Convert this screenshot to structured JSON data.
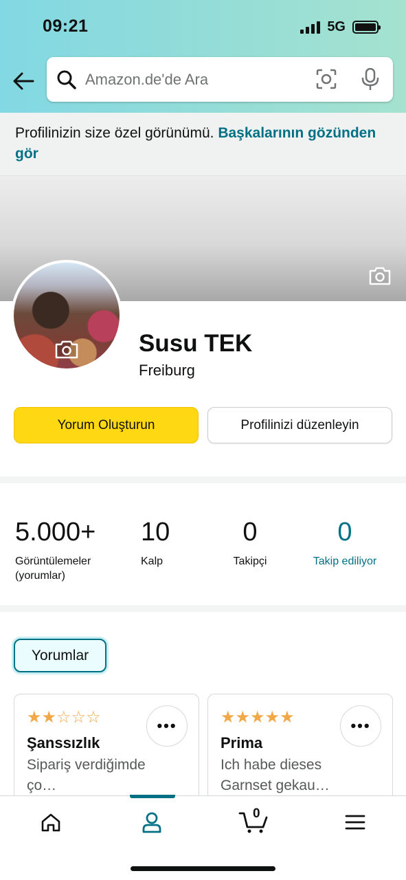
{
  "status_bar": {
    "time": "09:21",
    "network": "5G"
  },
  "search": {
    "placeholder": "Amazon.de'de Ara"
  },
  "banner": {
    "text": "Profilinizin size özel görünümü. ",
    "link": "Başkalarının gözünden gör"
  },
  "profile": {
    "name": "Susu TEK",
    "location": "Freiburg"
  },
  "actions": {
    "primary": "Yorum Oluşturun",
    "secondary": "Profilinizi düzenleyin"
  },
  "stats": [
    {
      "value": "5.000+",
      "label": "Görüntülemeler\n(yorumlar)"
    },
    {
      "value": "10",
      "label": "Kalp"
    },
    {
      "value": "0",
      "label": "Takipçi"
    },
    {
      "value": "0",
      "label": "Takip ediliyor"
    }
  ],
  "tabs": {
    "active": "Yorumlar"
  },
  "reviews": [
    {
      "rating": 2,
      "title": "Şanssızlık",
      "excerpt": "Sipariş verdiğimde ço…"
    },
    {
      "rating": 5,
      "title": "Prima",
      "excerpt": "Ich habe dieses Garnset gekau…"
    }
  ],
  "bottom_nav": {
    "items": [
      "home-icon",
      "profile-icon",
      "cart-icon",
      "menu-icon"
    ],
    "active_index": 1,
    "cart_count": "0"
  },
  "colors": {
    "accent": "#007185",
    "primary_button": "#FFD814",
    "star": "#F3A847"
  }
}
